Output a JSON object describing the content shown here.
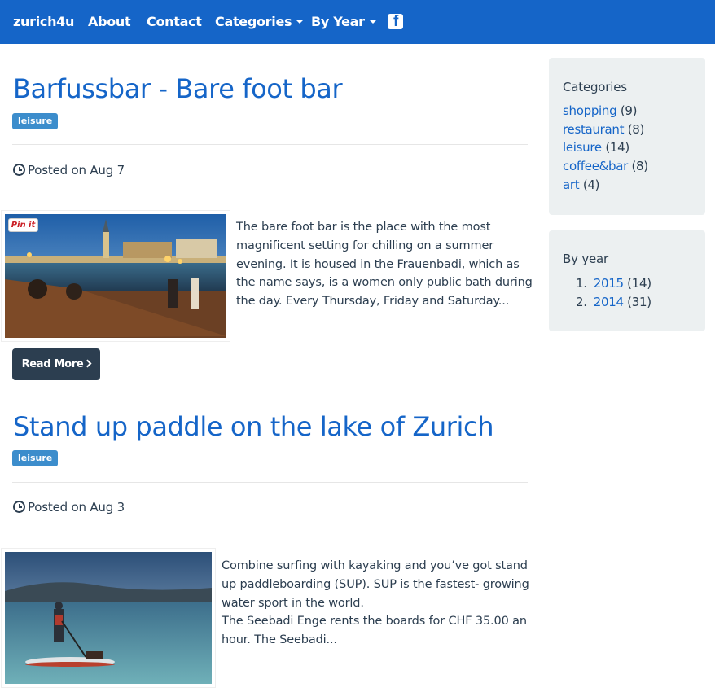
{
  "navbar": {
    "brand": "zurich4u",
    "links": {
      "about": "About",
      "contact": "Contact",
      "categories": "Categories",
      "by_year": "By Year"
    },
    "facebook_icon": "facebook-icon"
  },
  "posts": [
    {
      "title": "Barfussbar - Bare foot bar",
      "tag": "leisure",
      "posted": "Posted on Aug 7",
      "excerpt": "The bare foot bar is the place with the most magnificent setting for chilling on a summer evening. It is housed in the Frauenbadi, which as the name says, is a women only public bath during the day. Every Thursday, Friday and Saturday...",
      "pin_label": "Pin it",
      "read_more": "Read More"
    },
    {
      "title": "Stand up paddle on the lake of Zurich",
      "tag": "leisure",
      "posted": "Posted on Aug 3",
      "excerpt_lines": [
        "Combine surfing with kayaking and you’ve got stand up paddleboarding (SUP). SUP is the fastest- growing water sport in the world.",
        "The Seebadi Enge rents the boards for CHF 35.00 an hour. The Seebadi..."
      ]
    }
  ],
  "sidebar": {
    "categories": {
      "title": "Categories",
      "items": [
        {
          "label": "shopping",
          "count": "(9)"
        },
        {
          "label": "restaurant",
          "count": "(8)"
        },
        {
          "label": "leisure",
          "count": "(14)"
        },
        {
          "label": "coffee&bar",
          "count": "(8)"
        },
        {
          "label": "art",
          "count": "(4)"
        }
      ]
    },
    "by_year": {
      "title": "By year",
      "items": [
        {
          "num": "1.",
          "label": "2015",
          "count": "(14)"
        },
        {
          "num": "2.",
          "label": "2014",
          "count": "(31)"
        }
      ]
    }
  },
  "colors": {
    "brand_blue": "#1565c8",
    "dark_button": "#2c3e50",
    "tag_blue": "#3c8dcc",
    "sidebar_bg": "#ecf0f1"
  }
}
